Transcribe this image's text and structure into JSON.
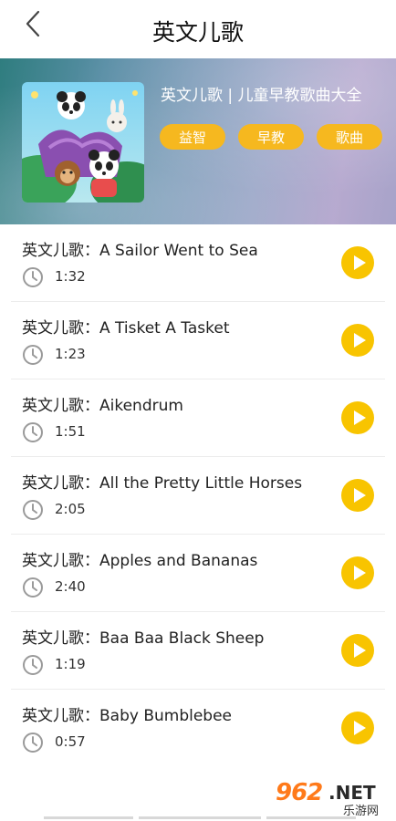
{
  "header": {
    "title": "英文儿歌"
  },
  "hero": {
    "title": "英文儿歌 | 儿童早教歌曲大全",
    "tags": [
      "益智",
      "早教",
      "歌曲"
    ]
  },
  "songs": [
    {
      "title": "英文儿歌：A Sailor Went to Sea",
      "duration": "1:32"
    },
    {
      "title": "英文儿歌：A Tisket A Tasket",
      "duration": "1:23"
    },
    {
      "title": "英文儿歌：Aikendrum",
      "duration": "1:51"
    },
    {
      "title": "英文儿歌：All the Pretty Little Horses",
      "duration": "2:05"
    },
    {
      "title": "英文儿歌：Apples and Bananas",
      "duration": "2:40"
    },
    {
      "title": "英文儿歌：Baa Baa Black Sheep",
      "duration": "1:19"
    },
    {
      "title": "英文儿歌：Baby Bumblebee",
      "duration": "0:57"
    }
  ],
  "watermark": {
    "number": "962",
    "suffix": ".NET",
    "sub": "乐游网"
  },
  "colors": {
    "accent": "#f6b81f",
    "play": "#f8c400"
  },
  "icons": {
    "back": "back-arrow-icon",
    "clock": "clock-icon",
    "play": "play-icon"
  }
}
